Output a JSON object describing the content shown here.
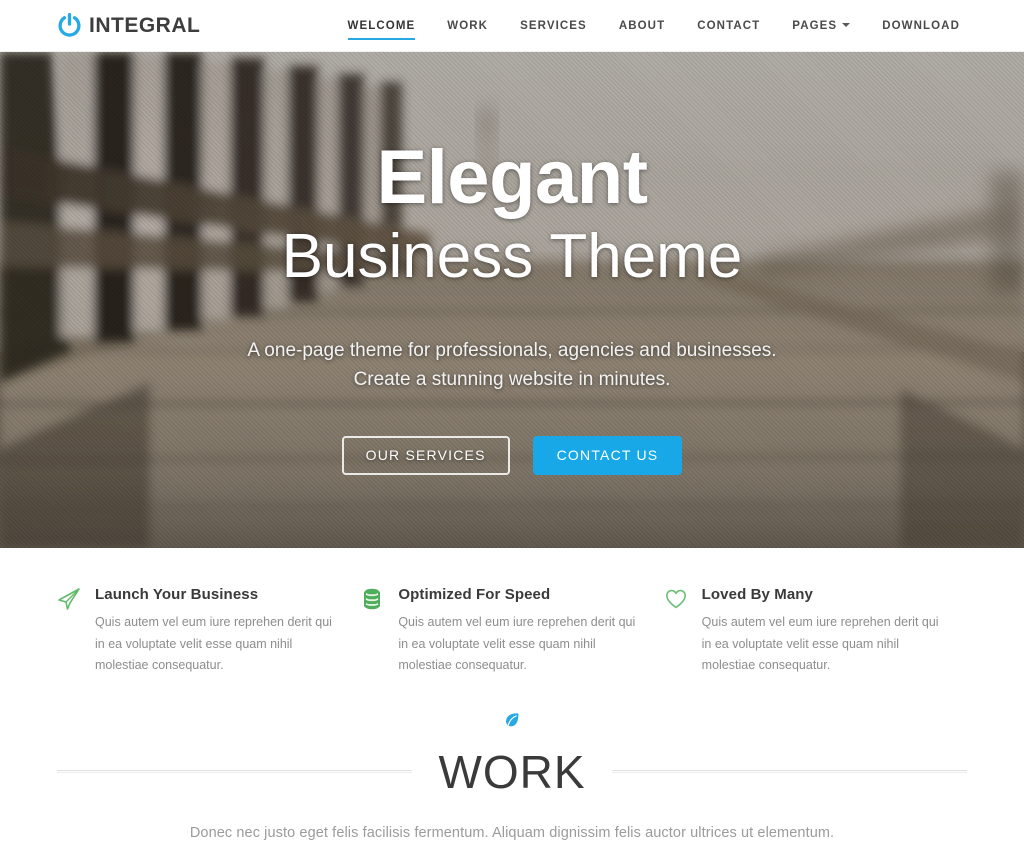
{
  "brand": {
    "name": "INTEGRAL",
    "icon": "power-icon",
    "color": "#27a9e3"
  },
  "nav": {
    "items": [
      {
        "label": "WELCOME",
        "active": true,
        "has_caret": false
      },
      {
        "label": "WORK",
        "active": false,
        "has_caret": false
      },
      {
        "label": "SERVICES",
        "active": false,
        "has_caret": false
      },
      {
        "label": "ABOUT",
        "active": false,
        "has_caret": false
      },
      {
        "label": "CONTACT",
        "active": false,
        "has_caret": false
      },
      {
        "label": "PAGES",
        "active": false,
        "has_caret": true
      },
      {
        "label": "DOWNLOAD",
        "active": false,
        "has_caret": false
      }
    ],
    "active_underline_color": "#27a9e3"
  },
  "hero": {
    "title_line1": "Elegant",
    "title_line2": "Business Theme",
    "subtitle_line1": "A one-page theme for professionals, agencies and businesses.",
    "subtitle_line2": "Create a stunning website in minutes.",
    "buttons": {
      "secondary_label": "OUR SERVICES",
      "primary_label": "CONTACT US",
      "primary_color": "#18a8e8"
    },
    "background_description": "blurred wooden pier with railing posts over water"
  },
  "features": [
    {
      "icon": "paper-plane-icon",
      "icon_color": "#62bb6a",
      "title": "Launch Your Business",
      "text": "Quis autem vel eum iure reprehen derit qui in ea voluptate velit esse quam nihil molestiae consequatur."
    },
    {
      "icon": "database-icon",
      "icon_color": "#4fae5a",
      "title": "Optimized For Speed",
      "text": "Quis autem vel eum iure reprehen derit qui in ea voluptate velit esse quam nihil molestiae consequatur."
    },
    {
      "icon": "heart-icon",
      "icon_color": "#6cc077",
      "title": "Loved By Many",
      "text": "Quis autem vel eum iure reprehen derit qui in ea voluptate velit esse quam nihil molestiae consequatur."
    }
  ],
  "work": {
    "leaf_icon": "leaf-icon",
    "leaf_color": "#27a9e3",
    "title": "WORK",
    "subtitle": "Donec nec justo eget felis facilisis fermentum. Aliquam dignissim felis auctor ultrices ut elementum."
  }
}
